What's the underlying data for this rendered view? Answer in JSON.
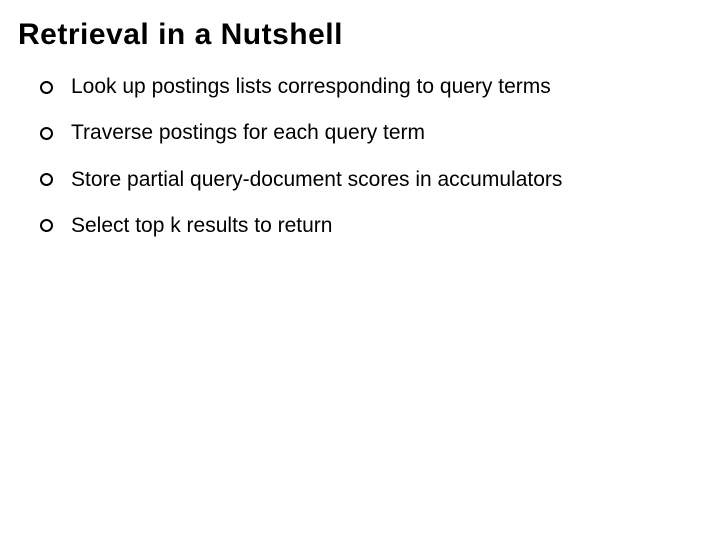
{
  "slide": {
    "title": "Retrieval in a Nutshell",
    "bullets": [
      "Look up postings lists corresponding to query terms",
      "Traverse postings for each query term",
      "Store partial query-document scores in accumulators",
      "Select top k results to return"
    ]
  }
}
